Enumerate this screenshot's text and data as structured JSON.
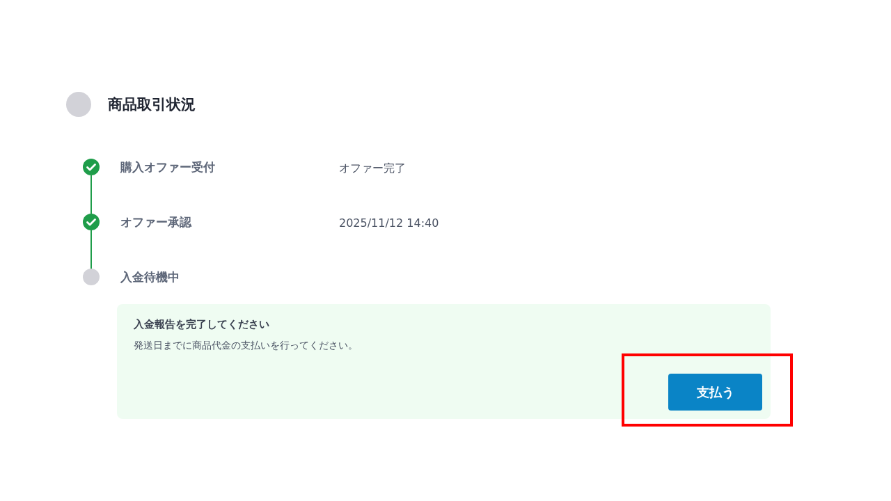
{
  "section": {
    "title": "商品取引状況"
  },
  "steps": [
    {
      "label": "購入オファー受付",
      "value": "オファー完了",
      "kind": "done"
    },
    {
      "label": "オファー承認",
      "value": "2025/11/12 14:40",
      "kind": "done"
    },
    {
      "label": "入金待機中",
      "kind": "pending"
    }
  ],
  "notice": {
    "title": "入金報告を完了してください",
    "message": "発送日までに商品代金の支払いを行ってください。",
    "button": {
      "label": "支払う",
      "highlighted": true
    }
  }
}
